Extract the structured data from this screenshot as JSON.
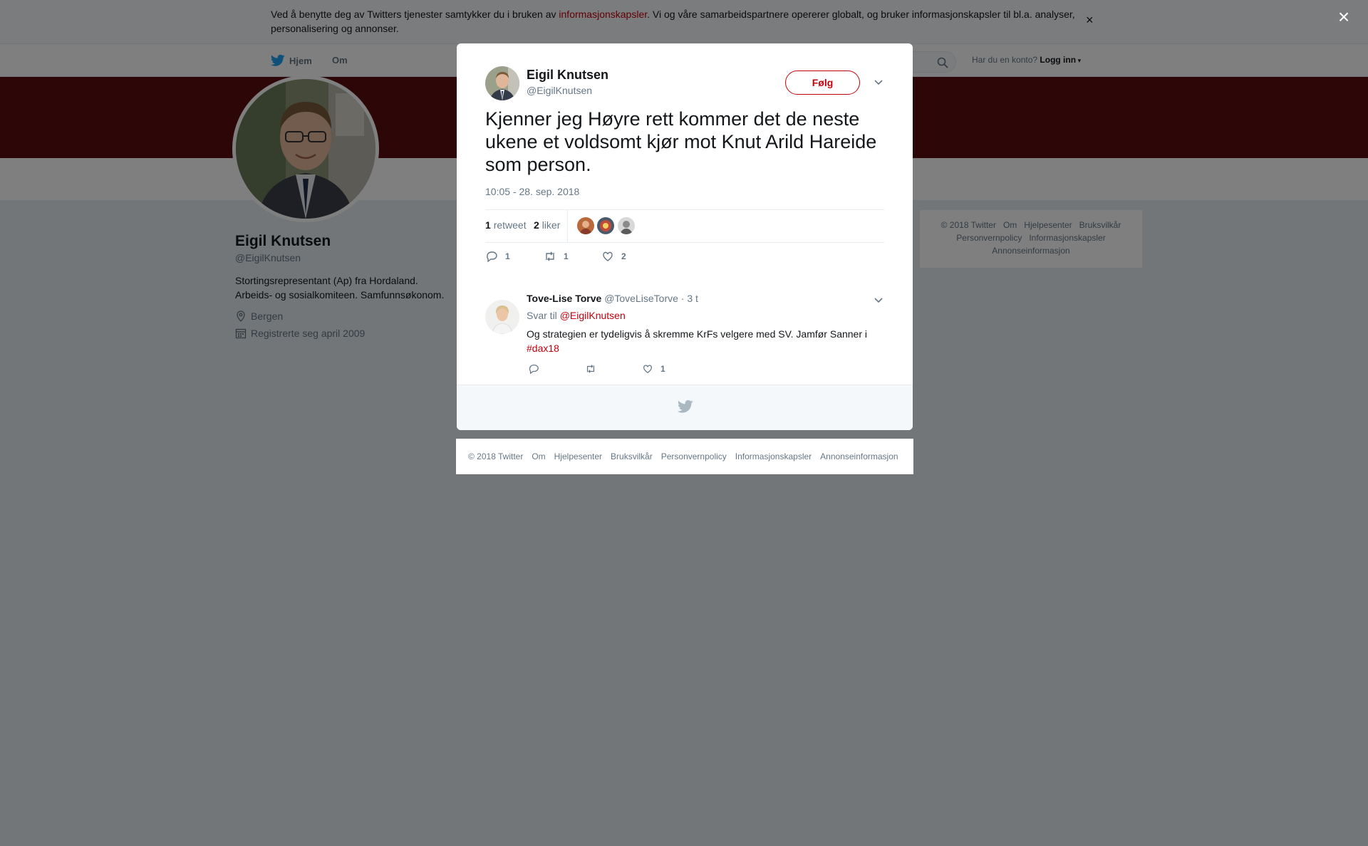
{
  "cookie_banner": {
    "text_before": "Ved å benytte deg av Twitters tjenester samtykker du i bruken av ",
    "link": "informasjonskapsler",
    "text_after": ". Vi og våre samarbeidspartnere opererer globalt, og bruker informasjonskapsler til bl.a. analyser, personalisering og annonser.",
    "close_glyph": "×"
  },
  "topnav": {
    "home_label": "Hjem",
    "about_label": "Om",
    "account_prompt": "Har du en konto?",
    "login_label": "Logg inn"
  },
  "profile": {
    "name": "Eigil Knutsen",
    "handle": "@EigilKnutsen",
    "bio": "Stortingsrepresentant (Ap) fra Hordaland. Arbeids- og sosialkomiteen. Samfunnsøkonom.",
    "location": "Bergen",
    "joined": "Registrerte seg april 2009"
  },
  "side_footer": {
    "links": [
      "© 2018 Twitter",
      "Om",
      "Hjelpesenter",
      "Bruksvilkår",
      "Personvernpolicy",
      "Informasjonskapsler",
      "Annonseinformasjon"
    ]
  },
  "overlay": {
    "close_glyph": "×"
  },
  "tweet": {
    "author_name": "Eigil Knutsen",
    "author_handle": "@EigilKnutsen",
    "follow_label": "Følg",
    "text": "Kjenner jeg Høyre rett kommer det de neste ukene et voldsomt kjør mot Knut Arild Hareide som person.",
    "timestamp": "10:05 - 28. sep. 2018",
    "retweet_count": "1",
    "retweet_label": "retweet",
    "like_count": "2",
    "like_label": "liker",
    "reply_action_count": "1",
    "retweet_action_count": "1",
    "like_action_count": "2"
  },
  "reply": {
    "name": "Tove-Lise Torve",
    "handle": "@ToveLiseTorve",
    "time": "· 3 t",
    "reply_to_prefix": "Svar til",
    "reply_to_mention": "@EigilKnutsen",
    "text": "Og strategien er tydeligvis å skremme KrFs velgere med SV. Jamfør Sanner i",
    "hashtag": "#dax18",
    "like_count": "1"
  },
  "bottom_footer": {
    "links": [
      "© 2018 Twitter",
      "Om",
      "Hjelpesenter",
      "Bruksvilkår",
      "Personvernpolicy",
      "Informasjonskapsler",
      "Annonseinformasjon"
    ]
  },
  "colors": {
    "accent": "#c4000d",
    "banner": "#5b0f10",
    "twitter_blue": "#1da1f2",
    "muted": "#657786"
  }
}
